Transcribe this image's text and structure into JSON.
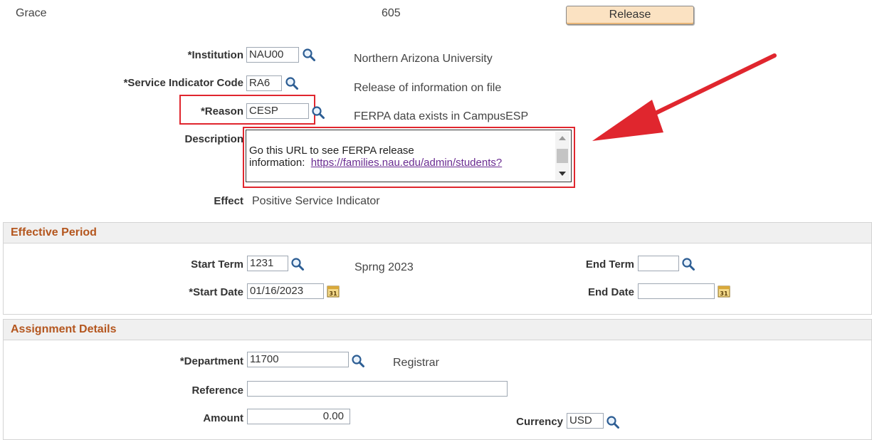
{
  "top": {
    "name": "Grace",
    "number": "605",
    "release_label": "Release"
  },
  "institution": {
    "label": "*Institution",
    "value": "NAU00",
    "description": "Northern Arizona University"
  },
  "service_indicator": {
    "label": "*Service Indicator Code",
    "value": "RA6",
    "description": "Release of information on file"
  },
  "reason": {
    "label": "*Reason",
    "value": "CESP",
    "description": "FERPA data exists in CampusESP"
  },
  "description": {
    "label": "Description",
    "line1": "Go this URL to see FERPA release",
    "line2_prefix": "information:",
    "link": "https://families.nau.edu/admin/students?"
  },
  "effect": {
    "label": "Effect",
    "value": "Positive Service Indicator"
  },
  "effective_period": {
    "title": "Effective Period",
    "start_term": {
      "label": "Start Term",
      "value": "1231",
      "description": "Sprng 2023"
    },
    "end_term": {
      "label": "End Term",
      "value": ""
    },
    "start_date": {
      "label": "*Start Date",
      "value": "01/16/2023"
    },
    "end_date": {
      "label": "End Date",
      "value": ""
    }
  },
  "assignment_details": {
    "title": "Assignment Details",
    "department": {
      "label": "*Department",
      "value": "11700",
      "description": "Registrar"
    },
    "reference": {
      "label": "Reference",
      "value": ""
    },
    "amount": {
      "label": "Amount",
      "value": "0.00"
    },
    "currency": {
      "label": "Currency",
      "value": "USD"
    }
  },
  "colors": {
    "section_title": "#b4561e",
    "annotation_red": "#e0262e"
  },
  "icons": {
    "lookup": "magnifier-icon",
    "calendar": "calendar-icon",
    "callout": "red-arrow"
  }
}
